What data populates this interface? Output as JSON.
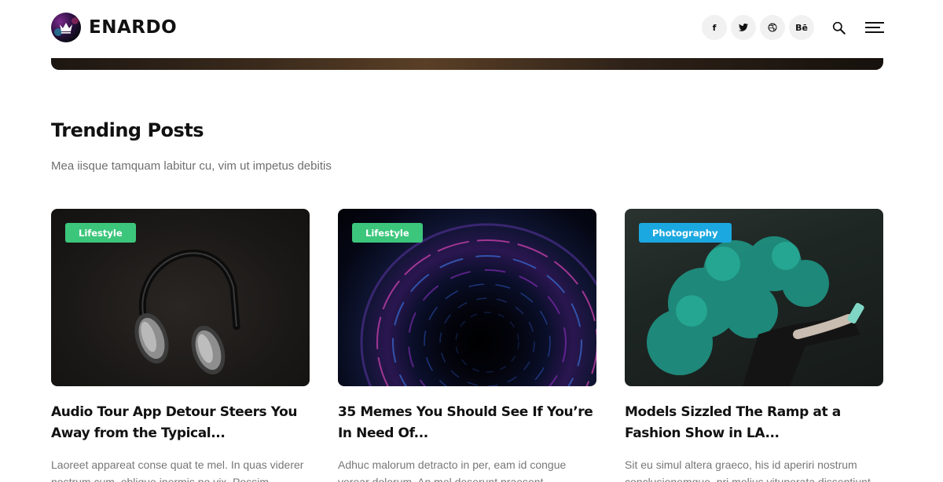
{
  "brand": {
    "name": "ENARDO",
    "logo_icon": "crown-icon"
  },
  "header": {
    "socials": [
      {
        "name": "facebook",
        "glyph": "f"
      },
      {
        "name": "twitter",
        "glyph": "t"
      },
      {
        "name": "dribbble",
        "glyph": "◎"
      },
      {
        "name": "behance",
        "glyph": "Bē"
      }
    ],
    "search_icon": "search-icon",
    "menu_icon": "hamburger-menu-icon"
  },
  "section": {
    "title": "Trending Posts",
    "subtitle": "Mea iisque tamquam labitur cu, vim ut impetus debitis"
  },
  "posts": [
    {
      "category": "Lifestyle",
      "category_color": "#3cc67c",
      "title": "Audio Tour App Detour Steers You Away from the Typical...",
      "excerpt": "Laoreet appareat conse quat te mel. In quas viderer nostrum cum, oblique inermis no vix. Possim"
    },
    {
      "category": "Lifestyle",
      "category_color": "#3cc67c",
      "title": "35 Memes You Should See If You’re In Need Of...",
      "excerpt": "Adhuc malorum detracto in per, eam id congue verear dolorum. An mel deserunt praesent"
    },
    {
      "category": "Photography",
      "category_color": "#1ba8e0",
      "title": "Models Sizzled The Ramp at a Fashion Show in LA...",
      "excerpt": "Sit eu simul altera graeco, his id aperiri nostrum conclusionemque, pri melius vituperata dissentiunt"
    }
  ]
}
